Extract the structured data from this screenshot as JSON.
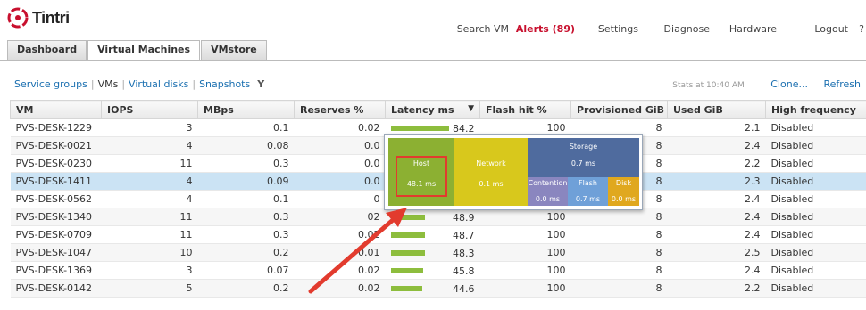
{
  "brand": {
    "name": "Tintri"
  },
  "topnav": {
    "search_vm": "Search VM",
    "alerts": "Alerts (89)",
    "settings": "Settings",
    "diagnose": "Diagnose",
    "hardware": "Hardware",
    "logout": "Logout",
    "help": "?"
  },
  "tabs": [
    {
      "label": "Dashboard",
      "active": false
    },
    {
      "label": "Virtual Machines",
      "active": true
    },
    {
      "label": "VMstore",
      "active": false
    }
  ],
  "subnav": {
    "service_groups": "Service groups",
    "vms": "VMs",
    "virtual_disks": "Virtual disks",
    "snapshots": "Snapshots",
    "filter_icon": "Y"
  },
  "rightbar": {
    "stats": "Stats at 10:40 AM",
    "clone": "Clone...",
    "refresh": "Refresh"
  },
  "table": {
    "headers": [
      "VM",
      "IOPS",
      "MBps",
      "Reserves %",
      "Latency ms",
      "Flash hit %",
      "Provisioned GiB",
      "Used GiB",
      "High frequency"
    ],
    "sort_indicator": "▼",
    "rows": [
      {
        "vm": "PVS-DESK-1229",
        "iops": "3",
        "mbps": "0.1",
        "reserves": "0.02",
        "latency": "84.2",
        "latency_value": 84.2,
        "flash": "100",
        "prov": "8",
        "used": "2.1",
        "hf": "Disabled"
      },
      {
        "vm": "PVS-DESK-0021",
        "iops": "4",
        "mbps": "0.08",
        "reserves": "0.0",
        "latency": "",
        "latency_value": 0,
        "flash": "",
        "prov": "8",
        "used": "2.4",
        "hf": "Disabled"
      },
      {
        "vm": "PVS-DESK-0230",
        "iops": "11",
        "mbps": "0.3",
        "reserves": "0.0",
        "latency": "",
        "latency_value": 0,
        "flash": "",
        "prov": "8",
        "used": "2.2",
        "hf": "Disabled"
      },
      {
        "vm": "PVS-DESK-1411",
        "iops": "4",
        "mbps": "0.09",
        "reserves": "0.0",
        "latency": "",
        "latency_value": 0,
        "flash": "",
        "prov": "8",
        "used": "2.3",
        "hf": "Disabled"
      },
      {
        "vm": "PVS-DESK-0562",
        "iops": "4",
        "mbps": "0.1",
        "reserves": "0",
        "latency": "",
        "latency_value": 0,
        "flash": "",
        "prov": "8",
        "used": "2.4",
        "hf": "Disabled"
      },
      {
        "vm": "PVS-DESK-1340",
        "iops": "11",
        "mbps": "0.3",
        "reserves": "02",
        "latency": "48.9",
        "latency_value": 48.9,
        "flash": "100",
        "prov": "8",
        "used": "2.4",
        "hf": "Disabled"
      },
      {
        "vm": "PVS-DESK-0709",
        "iops": "11",
        "mbps": "0.3",
        "reserves": "0.02",
        "latency": "48.7",
        "latency_value": 48.7,
        "flash": "100",
        "prov": "8",
        "used": "2.4",
        "hf": "Disabled"
      },
      {
        "vm": "PVS-DESK-1047",
        "iops": "10",
        "mbps": "0.2",
        "reserves": "0.01",
        "latency": "48.3",
        "latency_value": 48.3,
        "flash": "100",
        "prov": "8",
        "used": "2.5",
        "hf": "Disabled"
      },
      {
        "vm": "PVS-DESK-1369",
        "iops": "3",
        "mbps": "0.07",
        "reserves": "0.02",
        "latency": "45.8",
        "latency_value": 45.8,
        "flash": "100",
        "prov": "8",
        "used": "2.4",
        "hf": "Disabled"
      },
      {
        "vm": "PVS-DESK-0142",
        "iops": "5",
        "mbps": "0.2",
        "reserves": "0.02",
        "latency": "44.6",
        "latency_value": 44.6,
        "flash": "100",
        "prov": "8",
        "used": "2.2",
        "hf": "Disabled"
      }
    ]
  },
  "tooltip": {
    "host_label": "Host",
    "host_value": "48.1 ms",
    "network_label": "Network",
    "network_value": "0.1 ms",
    "storage_label": "Storage",
    "storage_value": "0.7 ms",
    "contention_label": "Contention",
    "contention_value": "0.0 ms",
    "flash_label": "Flash",
    "flash_value": "0.7 ms",
    "disk_label": "Disk",
    "disk_value": "0.0 ms"
  },
  "colors": {
    "brand_red": "#c8102e",
    "link_blue": "#1a6fb0",
    "latency_bar": "#8dbd3d",
    "selected_row": "#cbe3f4",
    "annotation_red": "#e23b2e"
  }
}
